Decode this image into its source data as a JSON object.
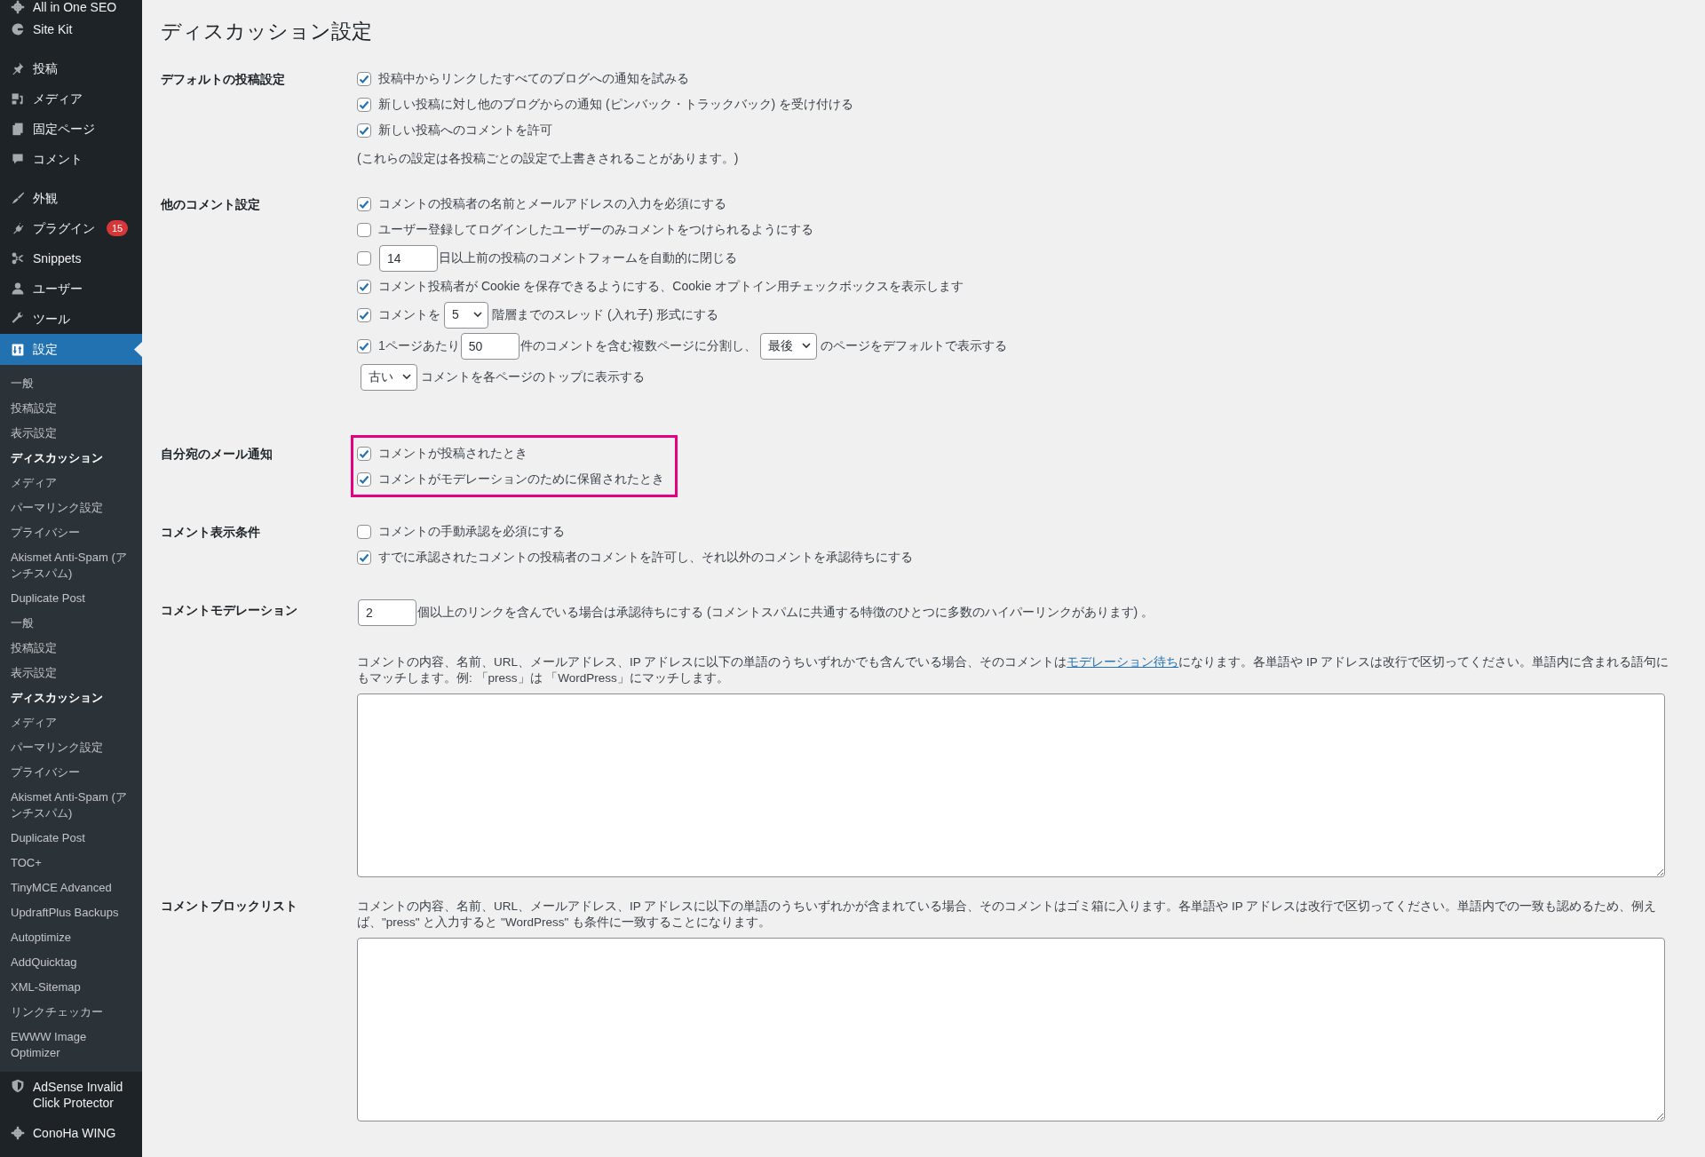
{
  "sidebar": {
    "groups": [
      {
        "items": [
          {
            "label": "All in One SEO",
            "selected": false
          },
          {
            "label": "Site Kit",
            "selected": false
          }
        ]
      },
      {
        "items": [
          {
            "label": "投稿",
            "selected": false
          },
          {
            "label": "メディア",
            "selected": false
          },
          {
            "label": "固定ページ",
            "selected": false
          },
          {
            "label": "コメント",
            "selected": false
          }
        ]
      },
      {
        "items": [
          {
            "label": "外観",
            "selected": false
          },
          {
            "label": "プラグイン",
            "selected": false,
            "badge": "15"
          },
          {
            "label": "Snippets",
            "selected": false
          },
          {
            "label": "ユーザー",
            "selected": false
          },
          {
            "label": "ツール",
            "selected": false
          },
          {
            "label": "設定",
            "selected": true,
            "children": [
              {
                "label": "一般",
                "selected": false
              },
              {
                "label": "投稿設定",
                "selected": false
              },
              {
                "label": "表示設定",
                "selected": false
              },
              {
                "label": "ディスカッション",
                "selected": true
              },
              {
                "label": "メディア",
                "selected": false
              },
              {
                "label": "パーマリンク設定",
                "selected": false
              },
              {
                "label": "プライバシー",
                "selected": false
              },
              {
                "label": "Akismet Anti-Spam (アンチスパム)",
                "selected": false
              },
              {
                "label": "Duplicate Post",
                "selected": false
              },
              {
                "label": "一般",
                "selected": false
              },
              {
                "label": "投稿設定",
                "selected": false
              },
              {
                "label": "表示設定",
                "selected": false
              },
              {
                "label": "ディスカッション",
                "selected": true
              },
              {
                "label": "メディア",
                "selected": false
              },
              {
                "label": "パーマリンク設定",
                "selected": false
              },
              {
                "label": "プライバシー",
                "selected": false
              },
              {
                "label": "Akismet Anti-Spam (アンチスパム)",
                "selected": false
              },
              {
                "label": "Duplicate Post",
                "selected": false
              },
              {
                "label": "TOC+",
                "selected": false
              },
              {
                "label": "TinyMCE Advanced",
                "selected": false
              },
              {
                "label": "UpdraftPlus Backups",
                "selected": false
              },
              {
                "label": "Autoptimize",
                "selected": false
              },
              {
                "label": "AddQuicktag",
                "selected": false
              },
              {
                "label": "XML-Sitemap",
                "selected": false
              },
              {
                "label": "リンクチェッカー",
                "selected": false
              },
              {
                "label": "EWWW Image Optimizer",
                "selected": false
              }
            ]
          },
          {
            "label": "AdSense Invalid Click Protector",
            "selected": false
          },
          {
            "label": "ConoHa WING",
            "selected": false
          }
        ]
      }
    ]
  },
  "title": "ディスカッション設定",
  "sections": [
    {
      "label": "デフォルトの投稿設定",
      "highlighted": false,
      "rows": [
        {
          "kind": "checkbox",
          "checked": true,
          "parts": [
            {
              "kind": "text",
              "text": "投稿中からリンクしたすべてのブログへの通知を試みる"
            }
          ]
        },
        {
          "kind": "checkbox",
          "checked": true,
          "parts": [
            {
              "kind": "text",
              "text": "新しい投稿に対し他のブログからの通知 (ピンバック・トラックバック) を受け付ける"
            }
          ]
        },
        {
          "kind": "checkbox",
          "checked": true,
          "parts": [
            {
              "kind": "text",
              "text": "新しい投稿へのコメントを許可"
            }
          ]
        },
        {
          "kind": "note",
          "text": "(これらの設定は各投稿ごとの設定で上書きされることがあります。)"
        }
      ]
    },
    {
      "label": "他のコメント設定",
      "highlighted": false,
      "rows": [
        {
          "kind": "checkbox",
          "checked": true,
          "parts": [
            {
              "kind": "text",
              "text": "コメントの投稿者の名前とメールアドレスの入力を必須にする"
            }
          ]
        },
        {
          "kind": "checkbox",
          "checked": false,
          "parts": [
            {
              "kind": "text",
              "text": "ユーザー登録してログインしたユーザーのみコメントをつけられるようにする"
            }
          ]
        },
        {
          "kind": "checkbox",
          "checked": false,
          "parts": [
            {
              "kind": "input",
              "value": "14"
            },
            {
              "kind": "text",
              "text": "日以上前の投稿のコメントフォームを自動的に閉じる"
            }
          ]
        },
        {
          "kind": "checkbox",
          "checked": true,
          "parts": [
            {
              "kind": "text",
              "text": "コメント投稿者が Cookie を保存できるようにする、Cookie オプトイン用チェックボックスを表示します"
            }
          ]
        },
        {
          "kind": "checkbox",
          "checked": true,
          "parts": [
            {
              "kind": "text",
              "text": "コメントを"
            },
            {
              "kind": "select",
              "value": "5"
            },
            {
              "kind": "text",
              "text": "階層までのスレッド (入れ子) 形式にする"
            }
          ]
        },
        {
          "kind": "checkbox",
          "checked": true,
          "parts": [
            {
              "kind": "text",
              "text": "1ページあたり"
            },
            {
              "kind": "input",
              "value": "50"
            },
            {
              "kind": "text",
              "text": "件のコメントを含む複数ページに分割し、"
            },
            {
              "kind": "select",
              "value": "最後"
            },
            {
              "kind": "text",
              "text": "のページをデフォルトで表示する"
            }
          ]
        },
        {
          "kind": "controls",
          "parts": [
            {
              "kind": "select",
              "value": "古い"
            },
            {
              "kind": "text",
              "text": "コメントを各ページのトップに表示する"
            }
          ]
        }
      ]
    },
    {
      "label": "自分宛のメール通知",
      "highlighted": true,
      "rows": [
        {
          "kind": "checkbox",
          "checked": true,
          "parts": [
            {
              "kind": "text",
              "text": "コメントが投稿されたとき"
            }
          ]
        },
        {
          "kind": "checkbox",
          "checked": true,
          "parts": [
            {
              "kind": "text",
              "text": "コメントがモデレーションのために保留されたとき"
            }
          ]
        }
      ]
    },
    {
      "label": "コメント表示条件",
      "highlighted": false,
      "rows": [
        {
          "kind": "checkbox",
          "checked": false,
          "parts": [
            {
              "kind": "text",
              "text": "コメントの手動承認を必須にする"
            }
          ]
        },
        {
          "kind": "checkbox",
          "checked": true,
          "parts": [
            {
              "kind": "text",
              "text": "すでに承認されたコメントの投稿者のコメントを許可し、それ以外のコメントを承認待ちにする"
            }
          ]
        }
      ]
    },
    {
      "label": "コメントモデレーション",
      "highlighted": false,
      "rows": [
        {
          "kind": "controls",
          "parts": [
            {
              "kind": "input",
              "value": "2"
            },
            {
              "kind": "text",
              "text": "個以上のリンクを含んでいる場合は承認待ちにする (コメントスパムに共通する特徴のひとつに多数のハイパーリンクがあります) 。"
            }
          ]
        },
        {
          "kind": "description",
          "parts": [
            {
              "kind": "text",
              "text": "コメントの内容、名前、URL、メールアドレス、IP アドレスに以下の単語のうちいずれかでも含んでいる場合、そのコメントは"
            },
            {
              "kind": "link",
              "text": "モデレーション待ち"
            },
            {
              "kind": "text",
              "text": "になります。各単語や IP アドレスは改行で区切ってください。単語内に含まれる語句にもマッチします。例: 「press」は 「WordPress」にマッチします。"
            }
          ]
        },
        {
          "kind": "textarea"
        }
      ]
    },
    {
      "label": "コメントブロックリスト",
      "highlighted": false,
      "rows": [
        {
          "kind": "description",
          "parts": [
            {
              "kind": "text",
              "text": "コメントの内容、名前、URL、メールアドレス、IP アドレスに以下の単語のうちいずれかが含まれている場合、そのコメントはゴミ箱に入ります。各単語や IP アドレスは改行で区切ってください。単語内での一致も認めるため、例えば、\"press\" と入力すると \"WordPress\" も条件に一致することになります。"
            }
          ]
        },
        {
          "kind": "textarea"
        }
      ]
    }
  ]
}
